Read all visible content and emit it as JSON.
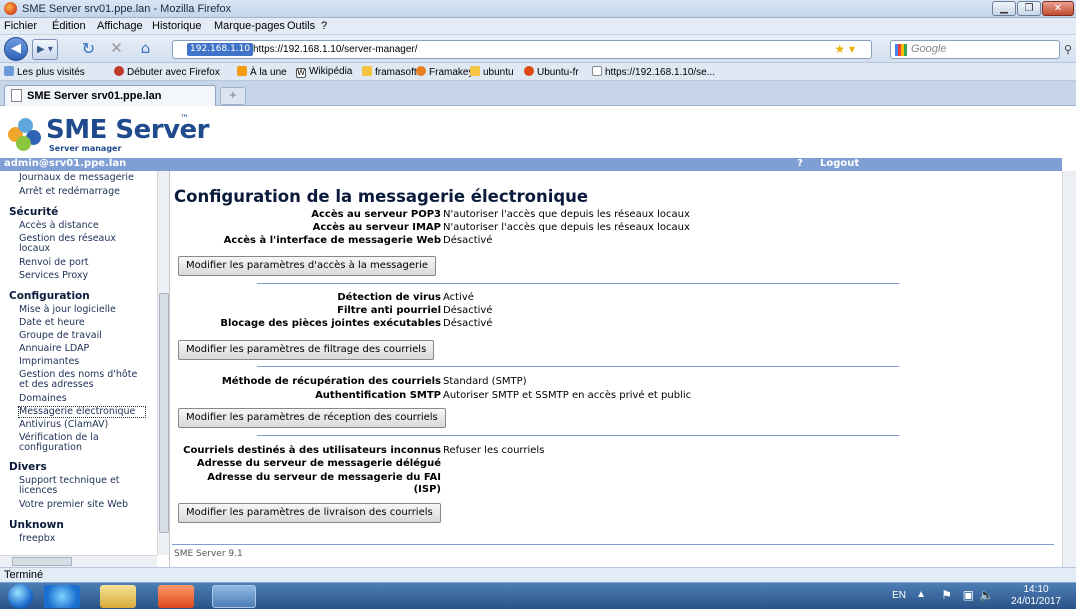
{
  "window": {
    "title": "SME Server srv01.ppe.lan - Mozilla Firefox"
  },
  "menu": [
    "Fichier",
    "Édition",
    "Affichage",
    "Historique",
    "Marque-pages",
    "Outils",
    "?"
  ],
  "address": {
    "site": "192.168.1.10",
    "url": "https://192.168.1.10/server-manager/"
  },
  "search": {
    "placeholder": "Google"
  },
  "bookmarks": [
    "Les plus visités",
    "Débuter avec Firefox",
    "À la une",
    "Wikipédia",
    "framasoft",
    "Framakey",
    "ubuntu",
    "Ubuntu-fr",
    "https://192.168.1.10/se..."
  ],
  "tab": {
    "label": "SME Server srv01.ppe.lan"
  },
  "header": {
    "logo": "SME Server",
    "subtitle": "Server manager",
    "tm": "™"
  },
  "userbar": {
    "user": "admin@srv01.ppe.lan",
    "help": "?",
    "logout": "Logout"
  },
  "sidebar": {
    "items": [
      {
        "label": "Journaux de messagerie",
        "heading": false
      },
      {
        "label": "Arrêt et redémarrage",
        "heading": false
      },
      {
        "label": "Sécurité",
        "heading": true
      },
      {
        "label": "Accès à distance",
        "heading": false
      },
      {
        "label": "Gestion des réseaux locaux",
        "heading": false
      },
      {
        "label": "Renvoi de port",
        "heading": false
      },
      {
        "label": "Services Proxy",
        "heading": false
      },
      {
        "label": "Configuration",
        "heading": true
      },
      {
        "label": "Mise à jour logicielle",
        "heading": false
      },
      {
        "label": "Date et heure",
        "heading": false
      },
      {
        "label": "Groupe de travail",
        "heading": false
      },
      {
        "label": "Annuaire LDAP",
        "heading": false
      },
      {
        "label": "Imprimantes",
        "heading": false
      },
      {
        "label": "Gestion des noms d'hôte et des adresses",
        "heading": false
      },
      {
        "label": "Domaines",
        "heading": false
      },
      {
        "label": "Messagerie électronique",
        "heading": false,
        "selected": true
      },
      {
        "label": "Antivirus (ClamAV)",
        "heading": false
      },
      {
        "label": "Vérification de la configuration",
        "heading": false
      },
      {
        "label": "Divers",
        "heading": true
      },
      {
        "label": "Support technique et licences",
        "heading": false
      },
      {
        "label": "Votre premier site Web",
        "heading": false
      },
      {
        "label": "Unknown",
        "heading": true
      },
      {
        "label": "freepbx",
        "heading": false
      }
    ]
  },
  "page": {
    "title": "Configuration de la messagerie électronique",
    "sections": [
      {
        "rows": [
          {
            "label": "Accès au serveur POP3",
            "value": "N'autoriser l'accès que depuis les réseaux locaux"
          },
          {
            "label": "Accès au serveur IMAP",
            "value": "N'autoriser l'accès que depuis les réseaux locaux"
          },
          {
            "label": "Accès à l'interface de messagerie Web",
            "value": "Désactivé"
          }
        ],
        "button": "Modifier les paramètres d'accès à la messagerie"
      },
      {
        "rows": [
          {
            "label": "Détection de virus",
            "value": "Activé"
          },
          {
            "label": "Filtre anti pourriel",
            "value": "Désactivé"
          },
          {
            "label": "Blocage des pièces jointes exécutables",
            "value": "Désactivé"
          }
        ],
        "button": "Modifier les paramètres de filtrage des courriels"
      },
      {
        "rows": [
          {
            "label": "Méthode de récupération des courriels",
            "value": "Standard (SMTP)"
          },
          {
            "label": "Authentification SMTP",
            "value": "Autoriser SMTP et SSMTP en accès privé et public"
          }
        ],
        "button": "Modifier les paramètres de réception des courriels"
      },
      {
        "rows": [
          {
            "label": "Courriels destinés à des utilisateurs inconnus",
            "value": "Refuser les courriels"
          },
          {
            "label": "Adresse du serveur de messagerie délégué",
            "value": ""
          },
          {
            "label": "Adresse du serveur de messagerie du FAI",
            "label2": "(ISP)",
            "value": ""
          }
        ],
        "button": "Modifier les paramètres de livraison des courriels"
      }
    ],
    "footer": "SME Server 9.1"
  },
  "status": "Terminé",
  "tray": {
    "lang": "EN",
    "time": "14:10",
    "date": "24/01/2017"
  }
}
